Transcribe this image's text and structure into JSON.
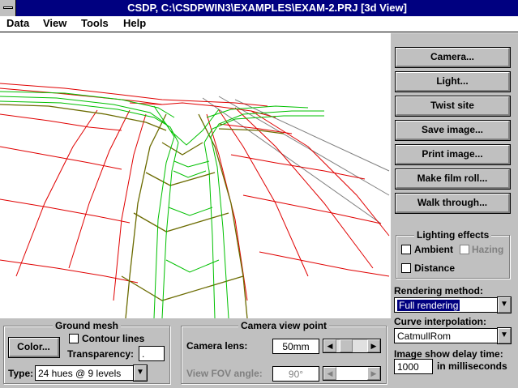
{
  "window": {
    "title": "CSDP, C:\\CSDPWIN3\\EXAMPLES\\EXAM-2.PRJ [3d View]"
  },
  "menu": {
    "items": [
      "Data",
      "View",
      "Tools",
      "Help"
    ]
  },
  "side_buttons": {
    "camera": "Camera...",
    "light": "Light...",
    "twist_site": "Twist site",
    "save_image": "Save image...",
    "print_image": "Print image...",
    "make_film_roll": "Make film roll...",
    "walk_through": "Walk through..."
  },
  "lighting": {
    "title": "Lighting effects",
    "ambient": "Ambient",
    "hazing": "Hazing",
    "distance": "Distance"
  },
  "rendering": {
    "label": "Rendering method:",
    "value": "Full rendering"
  },
  "curve": {
    "label": "Curve interpolation:",
    "value": "CatmullRom"
  },
  "delay": {
    "label": "Image show delay time:",
    "value": "1000",
    "unit": "in milliseconds"
  },
  "ground_mesh": {
    "title": "Ground mesh",
    "color_button": "Color...",
    "contour_lines": "Contour lines",
    "transparency_label": "Transparency:",
    "transparency_value": ".",
    "type_label": "Type:",
    "type_value": "24 hues @ 9 levels"
  },
  "camera_view": {
    "title": "Camera view point",
    "lens_label": "Camera lens:",
    "lens_value": "50mm",
    "fov_label": "View FOV angle:",
    "fov_value": "90°"
  },
  "colors": {
    "titlebar": "#000080",
    "panel": "#c0c0c0",
    "mesh_red": "#e00000",
    "road_green": "#00c000",
    "road_olive": "#6b6b00",
    "far_gray": "#808080"
  }
}
